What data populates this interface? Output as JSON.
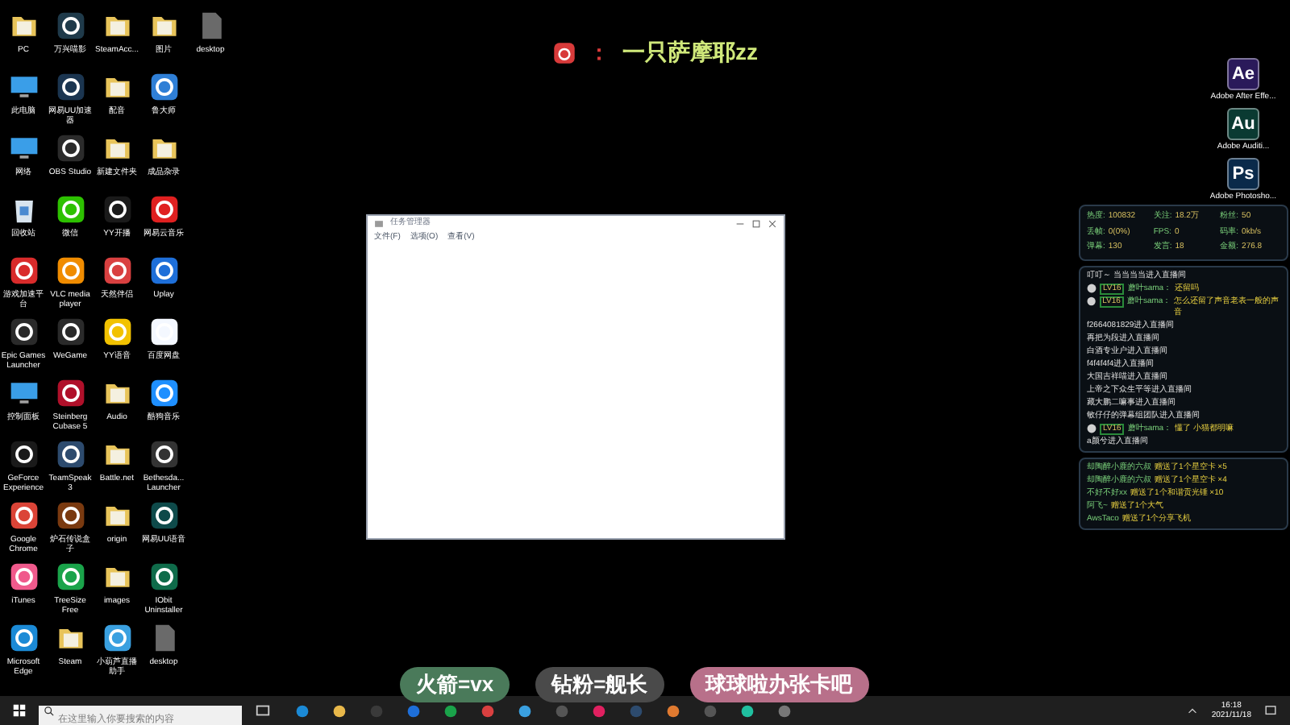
{
  "streamer": {
    "separator": "：",
    "name": "一只萨摩耶zz"
  },
  "desktop_icons": [
    {
      "label": "PC",
      "kind": "folder"
    },
    {
      "label": "万兴喵影",
      "kind": "app",
      "color": "#1f3a4a"
    },
    {
      "label": "SteamAcc...",
      "kind": "folder"
    },
    {
      "label": "图片",
      "kind": "folder"
    },
    {
      "label": "desktop",
      "kind": "file"
    },
    {
      "label": "此电脑",
      "kind": "monitor"
    },
    {
      "label": "网易UU加速器",
      "kind": "app",
      "color": "#1b3550"
    },
    {
      "label": "配音",
      "kind": "folder"
    },
    {
      "label": "鲁大师",
      "kind": "app",
      "color": "#2f7fd6"
    },
    {
      "kind": "none"
    },
    {
      "label": "网络",
      "kind": "monitor"
    },
    {
      "label": "OBS Studio",
      "kind": "app",
      "color": "#2b2b2b"
    },
    {
      "label": "新建文件夹",
      "kind": "folder"
    },
    {
      "label": "成品杂录",
      "kind": "folder"
    },
    {
      "kind": "none"
    },
    {
      "label": "回收站",
      "kind": "bin"
    },
    {
      "label": "微信",
      "kind": "app",
      "color": "#2dc100"
    },
    {
      "label": "YY开播",
      "kind": "app",
      "color": "#1a1a1a"
    },
    {
      "label": "网易云音乐",
      "kind": "app",
      "color": "#e02020"
    },
    {
      "kind": "none"
    },
    {
      "label": "游戏加速平台",
      "kind": "app",
      "color": "#d92b2b"
    },
    {
      "label": "VLC media player",
      "kind": "app",
      "color": "#f08c00"
    },
    {
      "label": "天然伴侣",
      "kind": "app",
      "color": "#d94040"
    },
    {
      "label": "Uplay",
      "kind": "app",
      "color": "#1e6fd9"
    },
    {
      "kind": "none"
    },
    {
      "label": "Epic Games Launcher",
      "kind": "app",
      "color": "#2a2a2a"
    },
    {
      "label": "WeGame",
      "kind": "app",
      "color": "#2a2a2a"
    },
    {
      "label": "YY语音",
      "kind": "app",
      "color": "#f2c200"
    },
    {
      "label": "百度网盘",
      "kind": "app",
      "color": "#f4f8ff"
    },
    {
      "kind": "none"
    },
    {
      "label": "控制面板",
      "kind": "monitor"
    },
    {
      "label": "Steinberg Cubase 5",
      "kind": "app",
      "color": "#b0102a"
    },
    {
      "label": "Audio",
      "kind": "folder"
    },
    {
      "label": "酷狗音乐",
      "kind": "app",
      "color": "#1e8fff"
    },
    {
      "kind": "none"
    },
    {
      "label": "GeForce Experience",
      "kind": "app",
      "color": "#1a1a1a"
    },
    {
      "label": "TeamSpeak 3",
      "kind": "app",
      "color": "#2d4b6e"
    },
    {
      "label": "Battle.net",
      "kind": "folder"
    },
    {
      "label": "Bethesda... Launcher",
      "kind": "app",
      "color": "#333333"
    },
    {
      "kind": "none"
    },
    {
      "label": "Google Chrome",
      "kind": "app",
      "color": "#db4437"
    },
    {
      "label": "炉石传说盒子",
      "kind": "app",
      "color": "#7a3a10"
    },
    {
      "label": "origin",
      "kind": "folder"
    },
    {
      "label": "网易UU语音",
      "kind": "app",
      "color": "#0e4a4a"
    },
    {
      "kind": "none"
    },
    {
      "label": "iTunes",
      "kind": "app",
      "color": "#f05a8c"
    },
    {
      "label": "TreeSize Free",
      "kind": "app",
      "color": "#1aa34a"
    },
    {
      "label": "images",
      "kind": "folder"
    },
    {
      "label": "IObit Uninstaller",
      "kind": "app",
      "color": "#0f6b4a"
    },
    {
      "kind": "none"
    },
    {
      "label": "Microsoft Edge",
      "kind": "app",
      "color": "#1b8ad6"
    },
    {
      "label": "Steam",
      "kind": "folder"
    },
    {
      "label": "小葫芦直播助手",
      "kind": "app",
      "color": "#3aa0e0"
    },
    {
      "label": "desktop",
      "kind": "file"
    },
    {
      "kind": "none"
    }
  ],
  "right_icons": [
    {
      "glyph": "Ae",
      "label": "Adobe After Effe...",
      "color": "#2a1a5a"
    },
    {
      "glyph": "Au",
      "label": "Adobe Auditi...",
      "color": "#0a3a32"
    },
    {
      "glyph": "Ps",
      "label": "Adobe Photosho...",
      "color": "#0a2a4a"
    }
  ],
  "stream_panel": {
    "stats": [
      {
        "label": "热度:",
        "value": "100832"
      },
      {
        "label": "关注:",
        "value": "18.2万"
      },
      {
        "label": "粉丝:",
        "value": "50"
      },
      {
        "label": "丢帧:",
        "value": "0(0%)"
      },
      {
        "label": "FPS:",
        "value": "0"
      },
      {
        "label": "码率:",
        "value": "0kb/s"
      },
      {
        "label": "弹幕:",
        "value": "130"
      },
      {
        "label": "发言:",
        "value": "18"
      },
      {
        "label": "金额:",
        "value": "276.8"
      }
    ],
    "chat": [
      {
        "kind": "enter",
        "text": "叮叮～ 当当当当进入直播间"
      },
      {
        "kind": "message",
        "badge": "LV16",
        "user": "蘑叶sama：",
        "text": "还留吗"
      },
      {
        "kind": "message",
        "badge": "LV16",
        "user": "蘑叶sama：",
        "text": "怎么还留了声音老表一般的声音"
      },
      {
        "kind": "enter",
        "text": "f2664081829进入直播间"
      },
      {
        "kind": "enter",
        "text": "再把为段进入直播间"
      },
      {
        "kind": "enter",
        "text": "白酒专业户进入直播间"
      },
      {
        "kind": "enter",
        "text": "f4f4f4f4进入直播间"
      },
      {
        "kind": "enter",
        "text": "大国吉祥喵进入直播间"
      },
      {
        "kind": "enter",
        "text": "上帝之下众生平等进入直播间"
      },
      {
        "kind": "enter",
        "text": "藏大鹏二嘛事进入直播间"
      },
      {
        "kind": "enter",
        "text": "敏仔仔的弹幕组团队进入直播间"
      },
      {
        "kind": "message",
        "badge": "LV16",
        "user": "蘑叶sama：",
        "text": "懂了 小猫都明嘛"
      },
      {
        "kind": "enter",
        "text": "a颜兮进入直播间"
      }
    ],
    "gifts": [
      {
        "user": "却陶醉小鹿的六叔",
        "text": "赠送了1个星空卡 ×5"
      },
      {
        "user": "却陶醉小鹿的六叔",
        "text": "赠送了1个星空卡 ×4"
      },
      {
        "user": "不好不好xx",
        "text": "赠送了1个和谐贡光锤 ×10"
      },
      {
        "user": "阿飞~",
        "text": "赠送了1个大气"
      },
      {
        "user": "AwsTaco",
        "text": "赠送了1个分享飞机"
      }
    ]
  },
  "window": {
    "title": "任务管理器",
    "menu": [
      "文件(F)",
      "选项(O)",
      "查看(V)"
    ]
  },
  "overlay_tags": [
    {
      "text": "火箭=vx",
      "color": "#4a7a5a"
    },
    {
      "text": "钻粉=舰长",
      "color": "#4a4a4a"
    },
    {
      "text": "球球啦办张卡吧",
      "color": "#b8708a"
    }
  ],
  "taskbar": {
    "search": {
      "placeholder": "在这里输入你要搜索的内容"
    },
    "apps": [
      {
        "color": "#1b8ad6"
      },
      {
        "color": "#e8b84a"
      },
      {
        "color": "#3a3a3a"
      },
      {
        "color": "#1e6fd9"
      },
      {
        "color": "#1aa34a"
      },
      {
        "color": "#d94040"
      },
      {
        "color": "#3aa0e0"
      },
      {
        "color": "#555555"
      },
      {
        "color": "#e02060"
      },
      {
        "color": "#2d4b6e"
      },
      {
        "color": "#e07a30"
      },
      {
        "color": "#555555"
      },
      {
        "color": "#20c0a0"
      },
      {
        "color": "#777777"
      }
    ],
    "time": "16:18",
    "date": "2021/11/18"
  }
}
